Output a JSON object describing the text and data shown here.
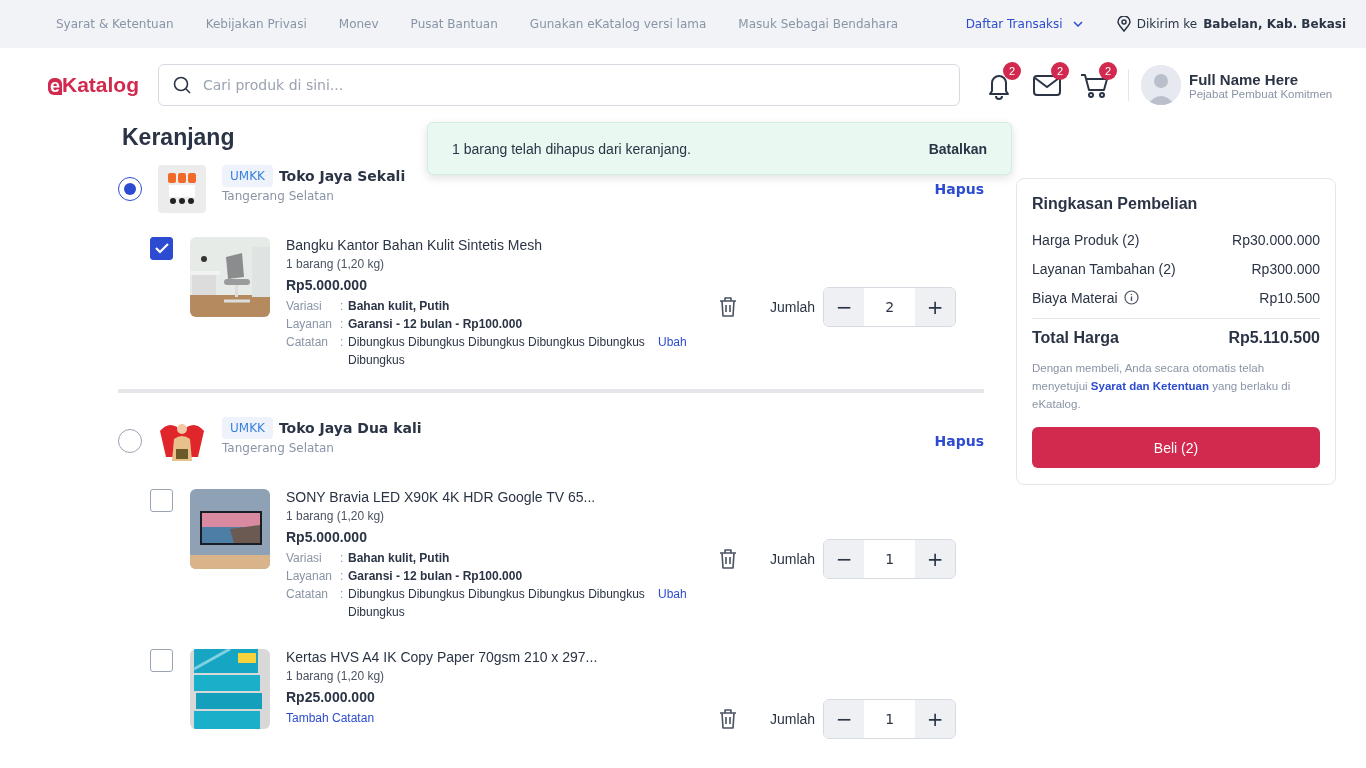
{
  "top_links": [
    "Syarat & Ketentuan",
    "Kebijakan Privasi",
    "Monev",
    "Pusat Bantuan",
    "Gunakan eKatalog versi lama",
    "Masuk Sebagai Bendahara"
  ],
  "transactions_menu": "Daftar Transaksi",
  "delivery": {
    "label": "Dikirim ke",
    "location": "Babelan, Kab. Bekasi"
  },
  "logo": {
    "mark": "e",
    "text": "Katalog"
  },
  "search": {
    "placeholder": "Cari produk di sini..."
  },
  "header_icons": [
    {
      "kind": "bell",
      "count": "2"
    },
    {
      "kind": "mail",
      "count": "2"
    },
    {
      "kind": "cart",
      "count": "2"
    }
  ],
  "user": {
    "name": "Full Name Here",
    "role": "Pejabat Pembuat Komitmen"
  },
  "page_title": "Keranjang",
  "toast": {
    "message": "1 barang telah dihapus dari keranjang.",
    "action": "Batalkan"
  },
  "shops": [
    {
      "selected": true,
      "badge": "UMKK",
      "name": "Toko Jaya Sekali",
      "location": "Tangerang Selatan",
      "delete": "Hapus",
      "items": [
        {
          "checked": true,
          "title": "Bangku Kantor Bahan Kulit Sintetis Mesh",
          "weight": "1 barang (1,20 kg)",
          "price": "Rp5.000.000",
          "details": [
            {
              "kind": "bold",
              "label": "Variasi",
              "separator": ":",
              "value": "Bahan kulit, Putih"
            },
            {
              "kind": "bold",
              "label": "Layanan",
              "separator": ":",
              "value": "Garansi - 12 bulan - Rp100.000"
            },
            {
              "kind": "note",
              "label": "Catatan",
              "separator": ":",
              "value": "Dibungkus Dibungkus Dibungkus Dibungkus Dibungkus Dibungkus",
              "link": "Ubah"
            }
          ],
          "quantity_label": "Jumlah",
          "quantity": "2",
          "minus": "−",
          "plus": "+"
        }
      ]
    },
    {
      "selected": false,
      "badge": "UMKK",
      "name": "Toko Jaya Dua kali",
      "location": "Tangerang Selatan",
      "delete": "Hapus",
      "items": [
        {
          "checked": false,
          "title": "SONY Bravia LED X90K 4K HDR Google TV 65...",
          "weight": "1 barang (1,20 kg)",
          "price": "Rp5.000.000",
          "details": [
            {
              "kind": "bold",
              "label": "Variasi",
              "separator": ":",
              "value": "Bahan kulit, Putih"
            },
            {
              "kind": "bold",
              "label": "Layanan",
              "separator": ":",
              "value": "Garansi - 12 bulan - Rp100.000"
            },
            {
              "kind": "note",
              "label": "Catatan",
              "separator": ":",
              "value": "Dibungkus Dibungkus Dibungkus Dibungkus Dibungkus Dibungkus",
              "link": "Ubah"
            }
          ],
          "quantity_label": "Jumlah",
          "quantity": "1",
          "minus": "−",
          "plus": "+"
        },
        {
          "checked": false,
          "title": "Kertas HVS A4 IK Copy Paper 70gsm 210 x 297...",
          "weight": "1 barang (1,20 kg)",
          "price": "Rp25.000.000",
          "add_note": "Tambah Catatan",
          "quantity_label": "Jumlah",
          "quantity": "1",
          "minus": "−",
          "plus": "+"
        }
      ]
    }
  ],
  "summary": {
    "title": "Ringkasan Pembelian",
    "rows": [
      {
        "label": "Harga Produk (2)",
        "value": "Rp30.000.000",
        "info": false
      },
      {
        "label": "Layanan Tambahan (2)",
        "value": "Rp300.000",
        "info": false
      },
      {
        "label": "Biaya Materai",
        "value": "Rp10.500",
        "info": true
      }
    ],
    "total": {
      "label": "Total Harga",
      "value": "Rp5.110.500"
    },
    "disclaimer": {
      "before": "Dengan membeli, Anda secara otomatis telah menyetujui ",
      "link": "Syarat dan Ketentuan",
      "after": " yang berlaku di eKatalog."
    },
    "button": "Beli (2)"
  }
}
